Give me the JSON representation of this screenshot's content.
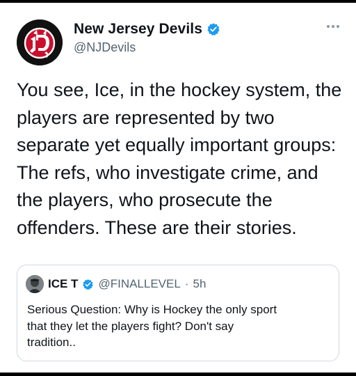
{
  "tweet": {
    "author_name": "New Jersey Devils",
    "author_handle": "@NJDevils",
    "text_lines": [
      "You see, Ice, in the hockey system, the",
      "players are represented by two",
      "separate yet equally important groups:",
      "The refs, who investigate crime, and",
      "the players, who prosecute the",
      "offenders. These are their stories."
    ]
  },
  "quoted_tweet": {
    "author_name": "ICE T",
    "author_handle": "@FINALLEVEL",
    "separator": "·",
    "time": "5h",
    "text_lines": [
      "Serious Question: Why is Hockey the only sport",
      "that they let the players fight? Don't say",
      "tradition.."
    ]
  },
  "icons": {
    "avatar": "new-jersey-devils-logo",
    "verified": "verified-badge-icon",
    "more": "more-options-icon"
  },
  "colors": {
    "verified_blue": "#1d9bf0",
    "devils_red": "#c8102e",
    "secondary_text": "#536471"
  }
}
